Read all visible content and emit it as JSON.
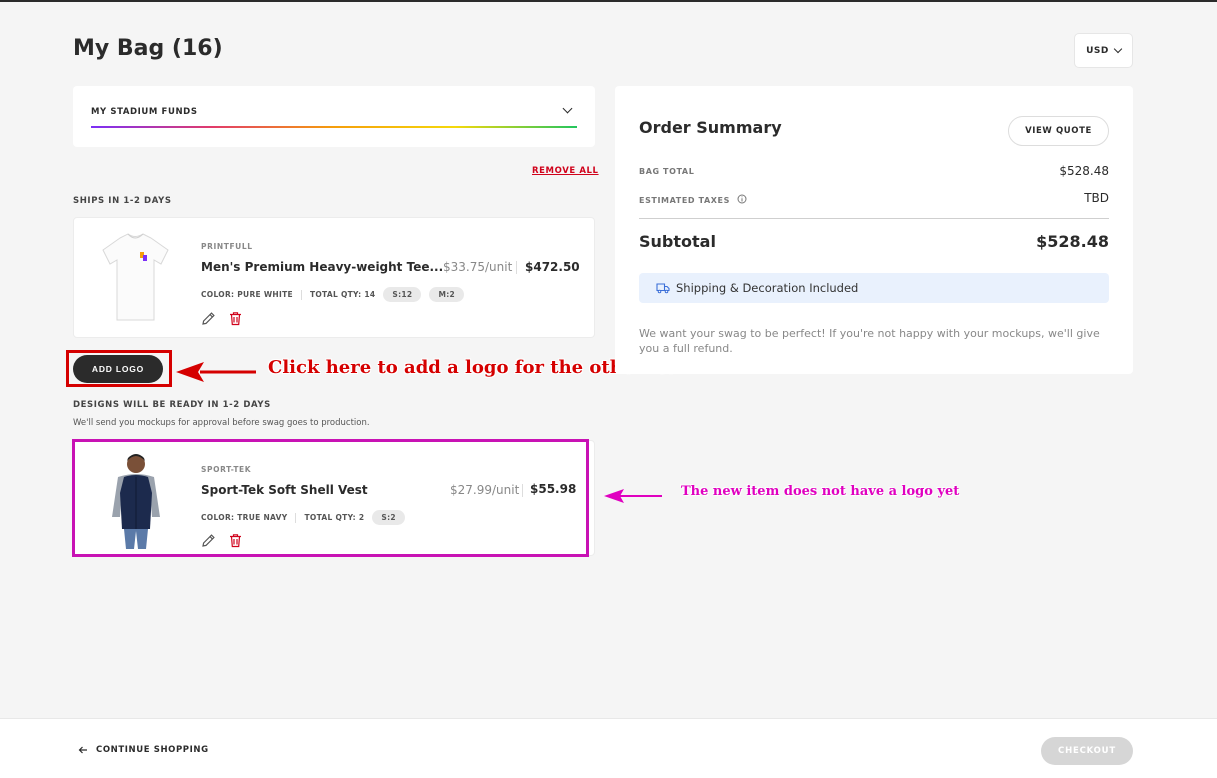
{
  "page": {
    "title": "My Bag (16)",
    "currency": "USD"
  },
  "funds": {
    "label": "MY STADIUM FUNDS"
  },
  "bag": {
    "remove_all": "REMOVE ALL",
    "section1": {
      "label": "SHIPS IN 1-2 DAYS",
      "item": {
        "vendor": "PRINTFULL",
        "name": "Men's Premium Heavy-weight Tee...",
        "unit_price": "$33.75/unit",
        "total": "$472.50",
        "color": "COLOR: PURE WHITE",
        "qty": "TOTAL QTY: 14",
        "sizes": [
          "S:12",
          "M:2"
        ]
      }
    },
    "add_logo": "ADD LOGO",
    "section2": {
      "label": "DESIGNS WILL BE READY IN 1-2 DAYS",
      "note": "We'll send you mockups for approval before swag goes to production.",
      "item": {
        "vendor": "SPORT-TEK",
        "name": "Sport-Tek Soft Shell Vest",
        "unit_price": "$27.99/unit",
        "total": "$55.98",
        "color": "COLOR: TRUE NAVY",
        "qty": "TOTAL QTY: 2",
        "sizes": [
          "S:2"
        ]
      }
    }
  },
  "annotations": {
    "add_logo": "Click here to add a logo for the other item",
    "new_item": "The new item does not have a logo yet"
  },
  "summary": {
    "title": "Order Summary",
    "view_quote": "VIEW QUOTE",
    "bag_total_label": "BAG TOTAL",
    "bag_total_value": "$528.48",
    "taxes_label": "ESTIMATED TAXES",
    "taxes_value": "TBD",
    "subtotal_label": "Subtotal",
    "subtotal_value": "$528.48",
    "shipping": "Shipping & Decoration Included",
    "refund": "We want your swag to be perfect! If you're not happy with your mockups, we'll give you a full refund."
  },
  "footer": {
    "continue": "CONTINUE SHOPPING",
    "checkout": "CHECKOUT"
  },
  "colors": {
    "accent_red": "#d0021b",
    "annotation_red": "#d50000",
    "annotation_magenta": "#c812b4",
    "info_bg": "#e9f1fd"
  }
}
